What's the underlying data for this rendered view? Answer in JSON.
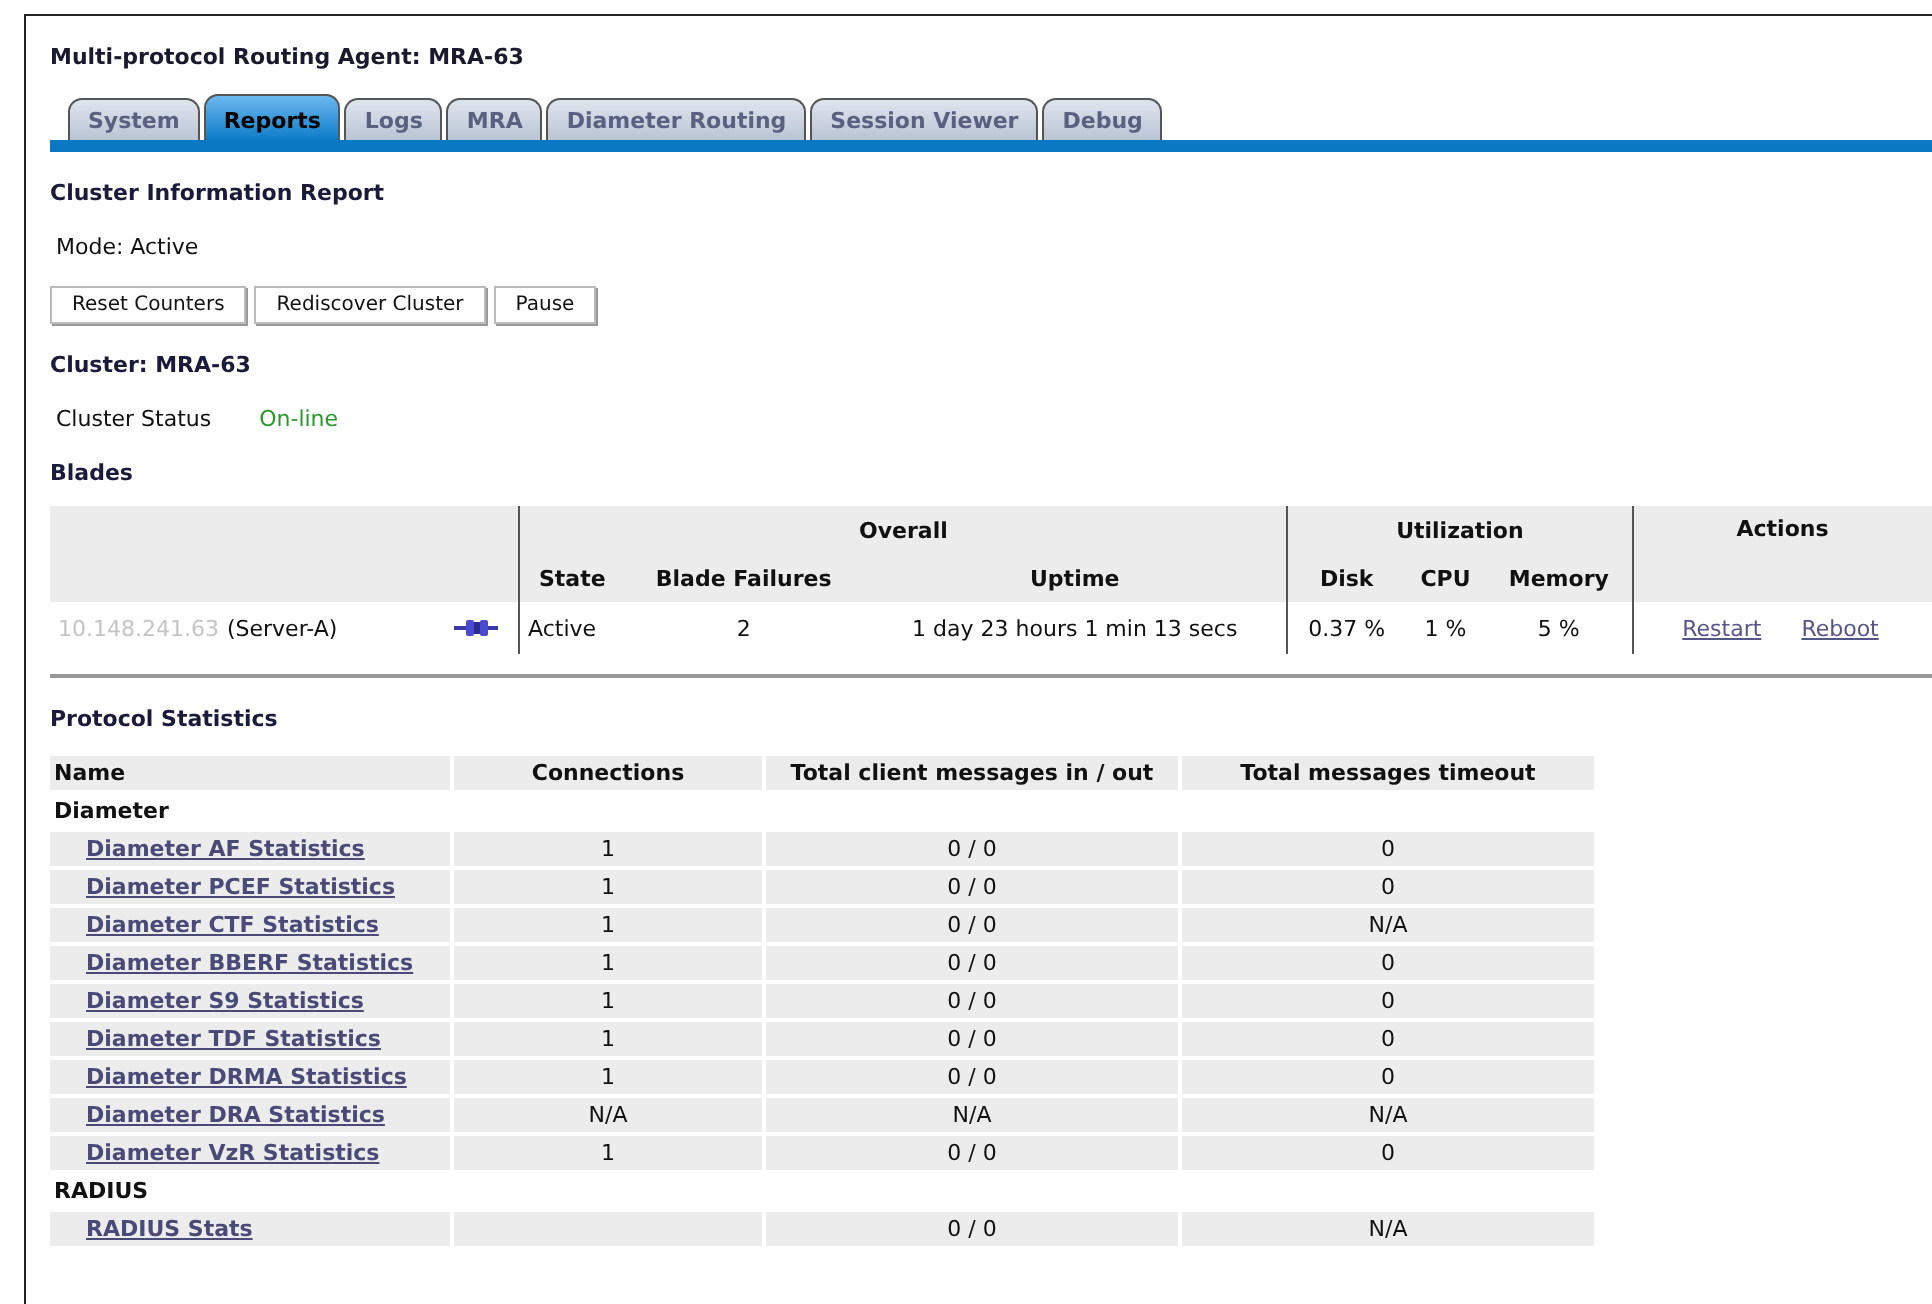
{
  "page_title": "Multi-protocol Routing Agent: MRA-63",
  "tabs": [
    {
      "label": "System",
      "selected": false
    },
    {
      "label": "Reports",
      "selected": true
    },
    {
      "label": "Logs",
      "selected": false
    },
    {
      "label": "MRA",
      "selected": false
    },
    {
      "label": "Diameter Routing",
      "selected": false
    },
    {
      "label": "Session Viewer",
      "selected": false
    },
    {
      "label": "Debug",
      "selected": false
    }
  ],
  "report": {
    "heading": "Cluster Information Report",
    "mode": "Mode: Active",
    "buttons": [
      "Reset Counters",
      "Rediscover Cluster",
      "Pause"
    ]
  },
  "cluster": {
    "heading": "Cluster: MRA-63",
    "status_label": "Cluster Status",
    "status_value": "On-line"
  },
  "blades": {
    "heading": "Blades",
    "groups": [
      "Overall",
      "Utilization",
      "Actions"
    ],
    "columns": [
      "State",
      "Blade Failures",
      "Uptime",
      "Disk",
      "CPU",
      "Memory"
    ],
    "rows": [
      {
        "address": "10.148.241.63",
        "name": "(Server-A)",
        "state": "Active",
        "blade_failures": "2",
        "uptime": "1 day 23 hours 1 min 13 secs",
        "disk": "0.37 %",
        "cpu": "1 %",
        "memory": "5 %",
        "actions": [
          "Restart",
          "Reboot"
        ]
      }
    ]
  },
  "protocol_statistics": {
    "heading": "Protocol Statistics",
    "columns": [
      "Name",
      "Connections",
      "Total client messages in / out",
      "Total messages timeout"
    ],
    "groups": [
      {
        "name": "Diameter",
        "rows": [
          {
            "name": "Diameter AF Statistics",
            "connections": "1",
            "messages": "0 / 0",
            "timeout": "0"
          },
          {
            "name": "Diameter PCEF Statistics",
            "connections": "1",
            "messages": "0 / 0",
            "timeout": "0"
          },
          {
            "name": "Diameter CTF Statistics",
            "connections": "1",
            "messages": "0 / 0",
            "timeout": "N/A"
          },
          {
            "name": "Diameter BBERF Statistics",
            "connections": "1",
            "messages": "0 / 0",
            "timeout": "0"
          },
          {
            "name": "Diameter S9 Statistics",
            "connections": "1",
            "messages": "0 / 0",
            "timeout": "0"
          },
          {
            "name": "Diameter TDF Statistics",
            "connections": "1",
            "messages": "0 / 0",
            "timeout": "0"
          },
          {
            "name": "Diameter DRMA Statistics",
            "connections": "1",
            "messages": "0 / 0",
            "timeout": "0"
          },
          {
            "name": "Diameter DRA Statistics",
            "connections": "N/A",
            "messages": "N/A",
            "timeout": "N/A"
          },
          {
            "name": "Diameter VzR Statistics",
            "connections": "1",
            "messages": "0 / 0",
            "timeout": "0"
          }
        ]
      },
      {
        "name": "RADIUS",
        "rows": [
          {
            "name": "RADIUS Stats",
            "messages": "0 / 0",
            "timeout": "N/A"
          }
        ]
      }
    ]
  }
}
